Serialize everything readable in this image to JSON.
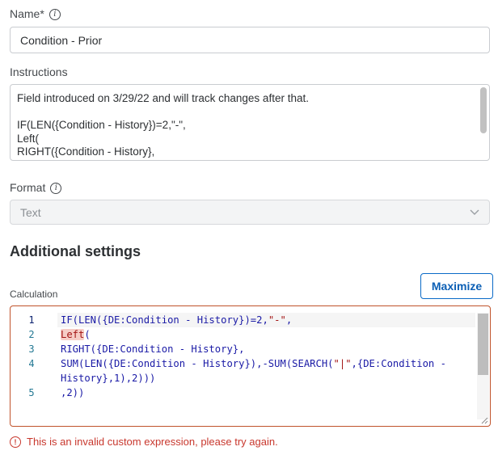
{
  "name_field": {
    "label": "Name*",
    "value": "Condition - Prior"
  },
  "instructions_field": {
    "label": "Instructions",
    "lines": [
      "Field introduced on 3/29/22 and will track changes after that.",
      "",
      "IF(LEN({Condition - History})=2,\"-\",",
      "Left(",
      "RIGHT({Condition - History},"
    ]
  },
  "format_field": {
    "label": "Format",
    "value": "Text"
  },
  "additional_settings": {
    "heading": "Additional settings"
  },
  "calculation": {
    "label": "Calculation",
    "maximize_label": "Maximize",
    "line_numbers": [
      "1",
      "2",
      "3",
      "4",
      "",
      "5"
    ],
    "lines": {
      "l1": "IF(LEN({DE:Condition - History})=2,",
      "l1_str": "\"-\"",
      "l1_end": ",",
      "l2_err": "Left",
      "l2_end": "(",
      "l3": "RIGHT({DE:Condition - History},",
      "l4": "SUM(LEN({DE:Condition - History}),-SUM(SEARCH(",
      "l4_str": "\"|\"",
      "l4_end": ",{DE:Condition -",
      "l4b": "History},1),2)))",
      "l5": ",2))"
    }
  },
  "error_message": "This is an invalid custom expression, please try again.",
  "colors": {
    "accent": "#0b5fb5",
    "error": "#c8372d",
    "editor_border": "#c0532b"
  },
  "icons": {
    "info": "info-icon",
    "chevron": "chevron-down-icon",
    "error": "alert-circle-icon"
  }
}
